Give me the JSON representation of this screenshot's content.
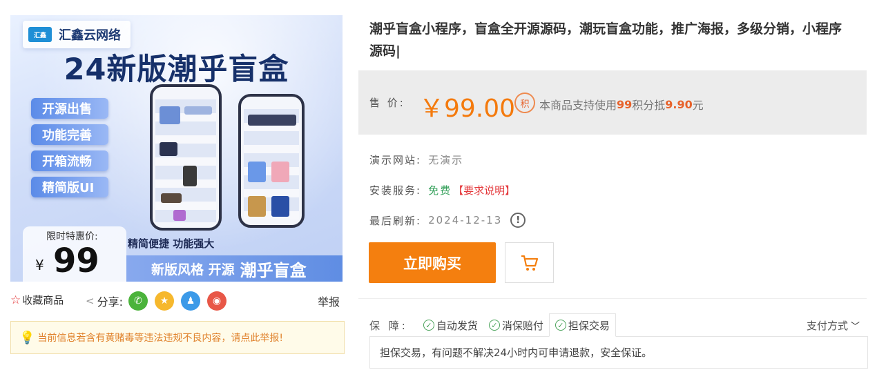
{
  "banner": {
    "brand_logo_text": "汇鑫",
    "brand_name": "汇鑫云网络",
    "title": "24新版潮乎盲盒",
    "features": [
      "开源出售",
      "功能完善",
      "开箱流畅",
      "精简版UI"
    ],
    "price_label": "限时特惠价:",
    "price_currency": "¥",
    "price_value": "99",
    "tagline": "精简便捷 功能强大",
    "strip_text": "新版风格 开源",
    "strip_highlight": "潮乎盲盒"
  },
  "actions": {
    "favorite": "收藏商品",
    "share_label": "分享:",
    "share_icons": [
      "wechat-icon",
      "qzone-icon",
      "qq-icon",
      "weibo-icon"
    ],
    "report": "举报"
  },
  "warning": "当前信息若含有黄赌毒等违法违规不良内容，请点此举报!",
  "product": {
    "title": "潮乎盲盒小程序，盲盒全开源源码，潮玩盲盒功能，推广海报，多级分销，小程序源码|",
    "price_label": "售 价:",
    "price": "￥99.00",
    "points_icon": "积",
    "points_prefix": "本商品支持使用",
    "points_amount": "99",
    "points_mid": "积分抵",
    "points_value": "9.90",
    "points_suffix": "元"
  },
  "details": {
    "demo_label": "演示网站:",
    "demo_value": "无演示",
    "install_label": "安装服务:",
    "install_value": "免费",
    "install_link": "【要求说明】",
    "refresh_label": "最后刷新:",
    "refresh_value": "2024-12-13"
  },
  "buttons": {
    "buy": "立即购买"
  },
  "guarantee": {
    "label": "保 障:",
    "tabs": [
      "自动发货",
      "消保赔付",
      "担保交易"
    ],
    "active_tab": 2,
    "pay_mode": "支付方式",
    "description": "担保交易，有问题不解决24小时内可申请退款，安全保证。"
  },
  "colors": {
    "accent_orange": "#f47f0f",
    "price_orange": "#f47a0d",
    "warning_red": "#e4393c",
    "success_green": "#4aa35a"
  }
}
